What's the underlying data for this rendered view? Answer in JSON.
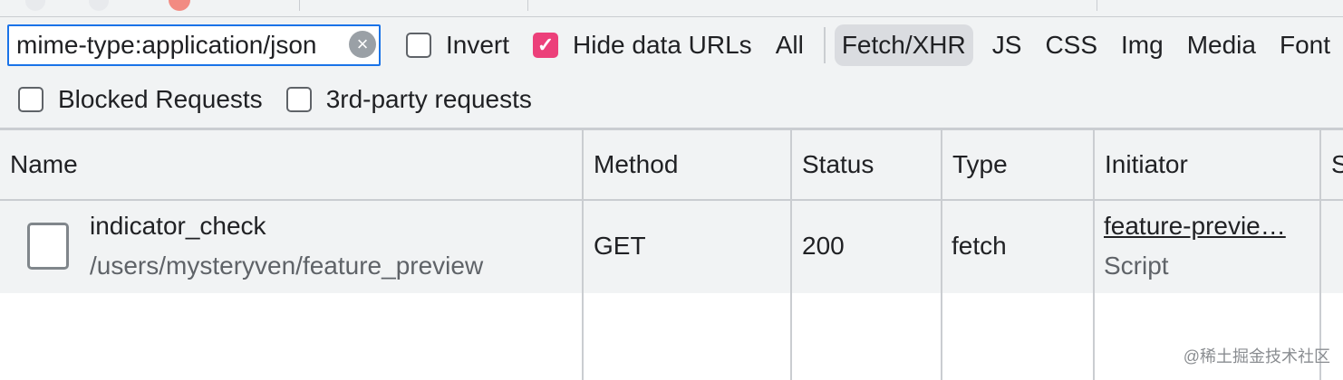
{
  "filter": {
    "value": "mime-type:application/json",
    "clear_glyph": "×",
    "invert_label": "Invert",
    "invert_checked": false,
    "hide_data_urls_label": "Hide data URLs",
    "hide_data_urls_checked": true,
    "accent_color": "#ec407a",
    "types": [
      "All",
      "Fetch/XHR",
      "JS",
      "CSS",
      "Img",
      "Media",
      "Font"
    ],
    "active_type": "Fetch/XHR",
    "blocked_requests_label": "Blocked Requests",
    "blocked_requests_checked": false,
    "third_party_label": "3rd-party requests",
    "third_party_checked": false
  },
  "table": {
    "columns": [
      "Name",
      "Method",
      "Status",
      "Type",
      "Initiator",
      "Size"
    ],
    "rows": [
      {
        "icon": "document-icon",
        "name": "indicator_check",
        "path": "/users/mysteryven/feature_preview",
        "method": "GET",
        "status": "200",
        "type": "fetch",
        "initiator": "feature-previe…",
        "initiator_type": "Script"
      }
    ]
  },
  "watermark": "@稀土掘金技术社区"
}
